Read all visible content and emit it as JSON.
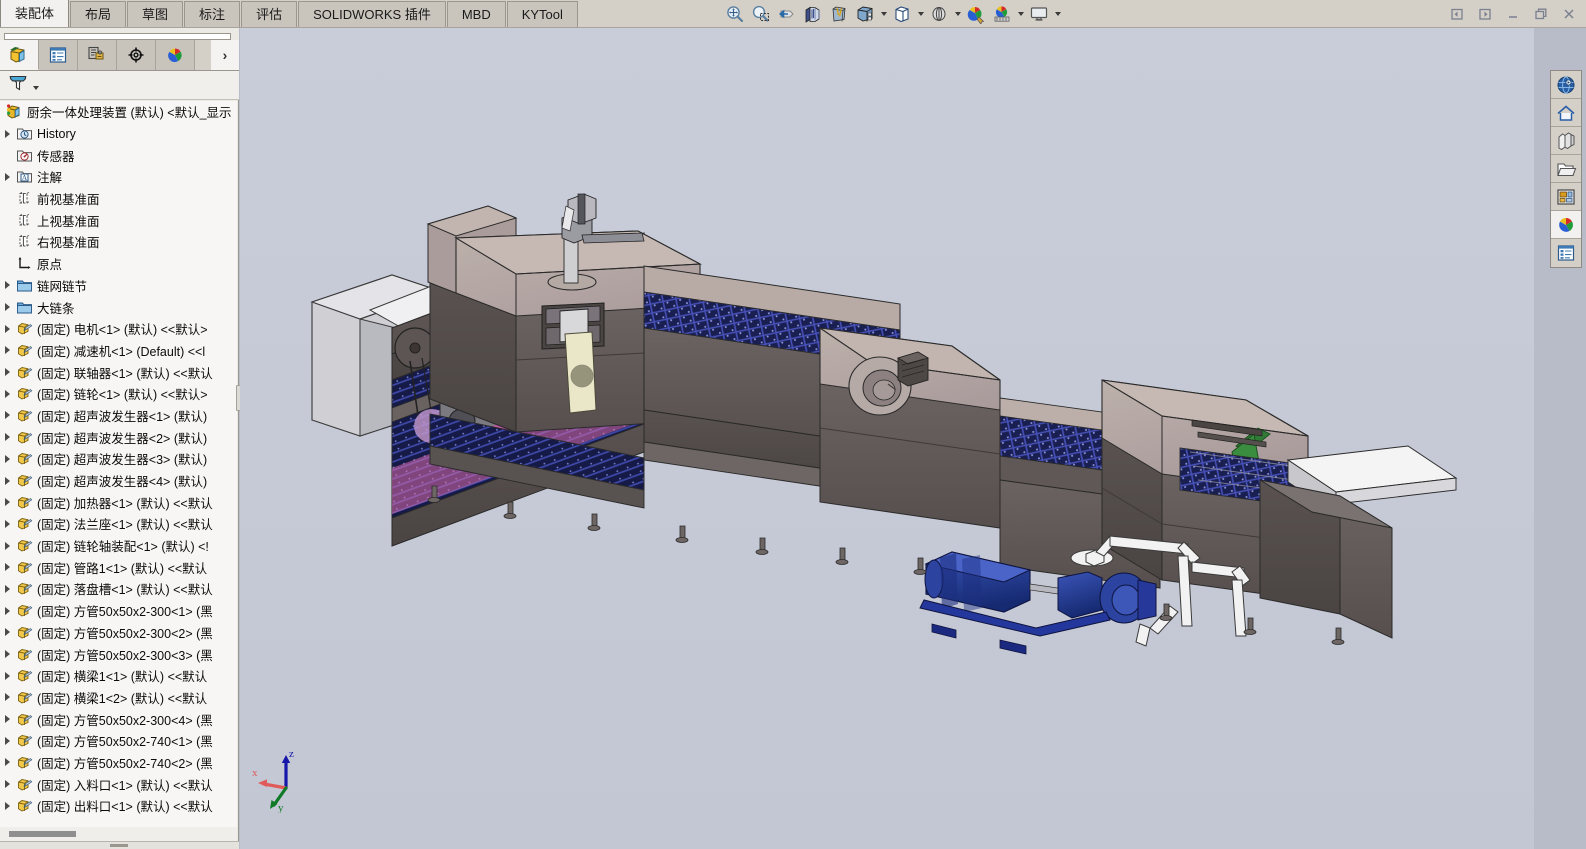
{
  "ribbon": {
    "tabs": [
      {
        "label": "装配体",
        "active": true
      },
      {
        "label": "布局",
        "active": false
      },
      {
        "label": "草图",
        "active": false
      },
      {
        "label": "标注",
        "active": false
      },
      {
        "label": "评估",
        "active": false
      },
      {
        "label": "SOLIDWORKS 插件",
        "active": false
      },
      {
        "label": "MBD",
        "active": false
      },
      {
        "label": "KYTool",
        "active": false
      }
    ],
    "view_tools": [
      {
        "name": "zoom-to-fit-icon",
        "caret": false
      },
      {
        "name": "zoom-to-area-icon",
        "caret": false
      },
      {
        "name": "previous-view-icon",
        "caret": false
      },
      {
        "name": "section-view-icon",
        "caret": false
      },
      {
        "name": "view-orientation-icon",
        "caret": false
      },
      {
        "name": "display-style-icon",
        "caret": true
      },
      {
        "name": "hide-show-items-icon",
        "caret": true
      },
      {
        "name": "edit-appearance-icon",
        "caret": true
      },
      {
        "name": "apply-scene-icon",
        "caret": false
      },
      {
        "name": "view-settings-icon",
        "caret": true
      },
      {
        "name": "viewport-icon",
        "caret": true
      }
    ],
    "window_controls": [
      {
        "name": "restore-left-icon"
      },
      {
        "name": "restore-right-icon"
      },
      {
        "name": "minimize-icon"
      },
      {
        "name": "maximize-icon"
      },
      {
        "name": "close-icon"
      }
    ]
  },
  "panel": {
    "tabs": [
      {
        "name": "feature-manager-tab",
        "active": true
      },
      {
        "name": "property-manager-tab",
        "active": false
      },
      {
        "name": "configuration-manager-tab",
        "active": false
      },
      {
        "name": "dimxpert-manager-tab",
        "active": false
      },
      {
        "name": "display-manager-tab",
        "active": false
      }
    ],
    "expand_arrow": "›",
    "filter_name": "filter-icon"
  },
  "tree": {
    "items": [
      {
        "label": "厨余一体处理装置 (默认) <默认_显示",
        "icon": "assembly-icon",
        "expandable": false,
        "indent": 0,
        "root": true
      },
      {
        "label": "History",
        "icon": "history-folder-icon",
        "expandable": true,
        "indent": 1
      },
      {
        "label": "传感器",
        "icon": "sensors-folder-icon",
        "expandable": false,
        "indent": 1
      },
      {
        "label": "注解",
        "icon": "annotations-folder-icon",
        "expandable": true,
        "indent": 1
      },
      {
        "label": "前视基准面",
        "icon": "plane-icon",
        "expandable": false,
        "indent": 1
      },
      {
        "label": "上视基准面",
        "icon": "plane-icon",
        "expandable": false,
        "indent": 1
      },
      {
        "label": "右视基准面",
        "icon": "plane-icon",
        "expandable": false,
        "indent": 1
      },
      {
        "label": "原点",
        "icon": "origin-icon",
        "expandable": false,
        "indent": 1
      },
      {
        "label": "链网链节",
        "icon": "folder-icon",
        "expandable": true,
        "indent": 1
      },
      {
        "label": "大链条",
        "icon": "folder-icon",
        "expandable": true,
        "indent": 1
      },
      {
        "label": "(固定) 电机<1> (默认) <<默认>",
        "icon": "component-icon",
        "expandable": true,
        "indent": 1
      },
      {
        "label": "(固定) 减速机<1> (Default) <<l",
        "icon": "component-icon",
        "expandable": true,
        "indent": 1
      },
      {
        "label": "(固定) 联轴器<1> (默认) <<默认",
        "icon": "component-icon",
        "expandable": true,
        "indent": 1
      },
      {
        "label": "(固定) 链轮<1> (默认) <<默认>",
        "icon": "component-icon",
        "expandable": true,
        "indent": 1
      },
      {
        "label": "(固定) 超声波发生器<1> (默认)",
        "icon": "component-icon",
        "expandable": true,
        "indent": 1
      },
      {
        "label": "(固定) 超声波发生器<2> (默认)",
        "icon": "component-icon",
        "expandable": true,
        "indent": 1
      },
      {
        "label": "(固定) 超声波发生器<3> (默认)",
        "icon": "component-icon",
        "expandable": true,
        "indent": 1
      },
      {
        "label": "(固定) 超声波发生器<4> (默认)",
        "icon": "component-icon",
        "expandable": true,
        "indent": 1
      },
      {
        "label": "(固定) 加热器<1> (默认) <<默认",
        "icon": "component-icon",
        "expandable": true,
        "indent": 1
      },
      {
        "label": "(固定) 法兰座<1> (默认) <<默认",
        "icon": "component-icon",
        "expandable": true,
        "indent": 1
      },
      {
        "label": "(固定) 链轮轴装配<1> (默认) <!",
        "icon": "component-icon",
        "expandable": true,
        "indent": 1
      },
      {
        "label": "(固定) 管路1<1> (默认) <<默认",
        "icon": "component-icon",
        "expandable": true,
        "indent": 1
      },
      {
        "label": "(固定) 落盘槽<1> (默认) <<默认",
        "icon": "component-icon",
        "expandable": true,
        "indent": 1
      },
      {
        "label": "(固定) 方管50x50x2-300<1> (黑",
        "icon": "component-icon",
        "expandable": true,
        "indent": 1
      },
      {
        "label": "(固定) 方管50x50x2-300<2> (黑",
        "icon": "component-icon",
        "expandable": true,
        "indent": 1
      },
      {
        "label": "(固定) 方管50x50x2-300<3> (黑",
        "icon": "component-icon",
        "expandable": true,
        "indent": 1
      },
      {
        "label": "(固定) 横梁1<1> (默认) <<默认",
        "icon": "component-icon",
        "expandable": true,
        "indent": 1
      },
      {
        "label": "(固定) 横梁1<2> (默认) <<默认",
        "icon": "component-icon",
        "expandable": true,
        "indent": 1
      },
      {
        "label": "(固定) 方管50x50x2-300<4> (黑",
        "icon": "component-icon",
        "expandable": true,
        "indent": 1
      },
      {
        "label": "(固定) 方管50x50x2-740<1> (黑",
        "icon": "component-icon",
        "expandable": true,
        "indent": 1
      },
      {
        "label": "(固定) 方管50x50x2-740<2> (黑",
        "icon": "component-icon",
        "expandable": true,
        "indent": 1
      },
      {
        "label": "(固定) 入料口<1> (默认) <<默认",
        "icon": "component-icon",
        "expandable": true,
        "indent": 1
      },
      {
        "label": "(固定) 出料口<1> (默认) <<默认",
        "icon": "component-icon",
        "expandable": true,
        "indent": 1
      }
    ]
  },
  "task_pane": {
    "buttons": [
      {
        "name": "solidworks-resources-icon"
      },
      {
        "name": "design-library-home-icon"
      },
      {
        "name": "file-explorer-library-icon"
      },
      {
        "name": "open-folder-icon"
      },
      {
        "name": "view-palette-icon"
      },
      {
        "name": "appearances-scenes-icon"
      },
      {
        "name": "custom-properties-icon"
      }
    ]
  },
  "viewport": {
    "triad": {
      "x_label": "x",
      "y_label": "y",
      "z_label": "z"
    },
    "background_color": "#c5c9d6",
    "model_name": "厨余一体处理装置"
  }
}
